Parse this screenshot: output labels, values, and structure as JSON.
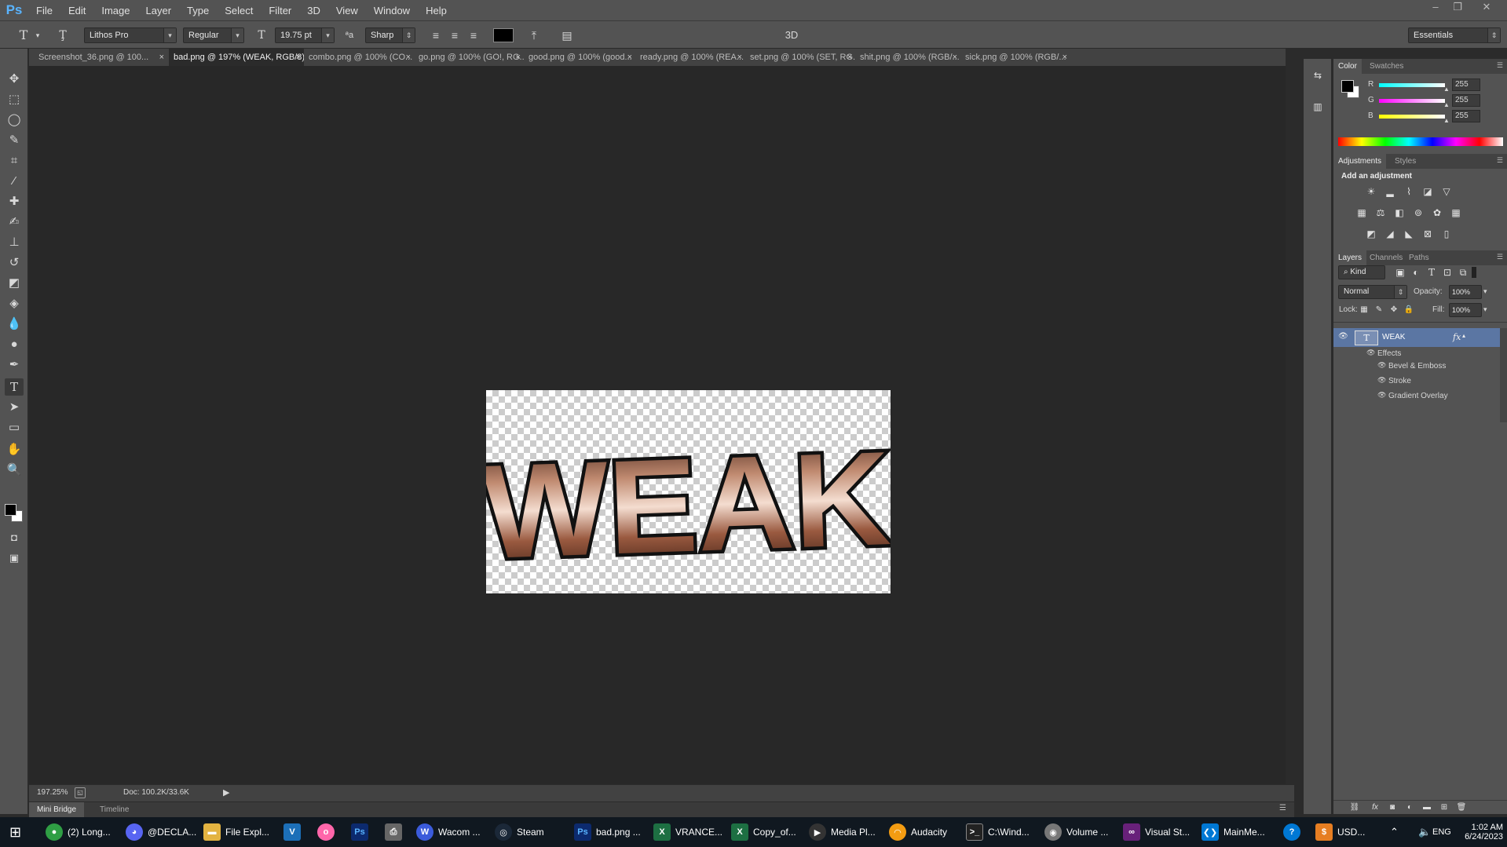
{
  "app": {
    "logo": "Ps"
  },
  "menu": [
    "File",
    "Edit",
    "Image",
    "Layer",
    "Type",
    "Select",
    "Filter",
    "3D",
    "View",
    "Window",
    "Help"
  ],
  "options": {
    "font_family": "Lithos Pro",
    "font_style": "Regular",
    "font_size": "19.75 pt",
    "antialias": "Sharp",
    "label_3d": "3D",
    "workspace": "Essentials",
    "text_color": "#000000"
  },
  "tabs": [
    {
      "label": "Screenshot_36.png @ 100..."
    },
    {
      "label": "bad.png @ 197% (WEAK, RGB/8) *"
    },
    {
      "label": "combo.png @ 100% (CO..."
    },
    {
      "label": "go.png @ 100% (GO!, RG..."
    },
    {
      "label": "good.png @ 100% (good..."
    },
    {
      "label": "ready.png @ 100% (REA..."
    },
    {
      "label": "set.png @ 100% (SET, RG..."
    },
    {
      "label": "shit.png @ 100% (RGB/..."
    },
    {
      "label": "sick.png @ 100% (RGB/..."
    }
  ],
  "canvas": {
    "text": "WEAK"
  },
  "status": {
    "zoom": "197.25%",
    "doc": "Doc: 100.2K/33.6K"
  },
  "bottom_tabs": [
    "Mini Bridge",
    "Timeline"
  ],
  "color_panel": {
    "tabs": [
      "Color",
      "Swatches"
    ],
    "r": "255",
    "g": "255",
    "b": "255",
    "labels": [
      "R",
      "G",
      "B"
    ]
  },
  "adjust_panel": {
    "tabs": [
      "Adjustments",
      "Styles"
    ],
    "heading": "Add an adjustment"
  },
  "layers_panel": {
    "tabs": [
      "Layers",
      "Channels",
      "Paths"
    ],
    "kind": "Kind",
    "blend": "Normal",
    "opacity_label": "Opacity:",
    "opacity": "100%",
    "lock_label": "Lock:",
    "fill_label": "Fill:",
    "fill": "100%",
    "layer_name": "WEAK",
    "effects_label": "Effects",
    "effects": [
      "Bevel & Emboss",
      "Stroke",
      "Gradient Overlay"
    ]
  },
  "taskbar": {
    "items": [
      {
        "label": "(2) Long...",
        "icon": "chrome-icon",
        "color": "#2f9e44"
      },
      {
        "label": "@DECLA...",
        "icon": "discord-icon",
        "color": "#5865f2"
      },
      {
        "label": "File Expl...",
        "icon": "folder-icon",
        "color": "#e3b341"
      },
      {
        "label": "",
        "icon": "vegas-icon",
        "color": "#1c6fb8"
      },
      {
        "label": "",
        "icon": "osu-icon",
        "color": "#ff66aa"
      },
      {
        "label": "",
        "icon": "photoshop-icon",
        "color": "#0c2a6e"
      },
      {
        "label": "",
        "icon": "printer-icon",
        "color": "#666"
      },
      {
        "label": "Wacom ...",
        "icon": "wacom-icon",
        "color": "#3b5bdb"
      },
      {
        "label": "Steam",
        "icon": "steam-icon",
        "color": "#1b2838"
      },
      {
        "label": "bad.png ...",
        "icon": "photoshop-icon",
        "color": "#0c2a6e"
      },
      {
        "label": "VRANCE...",
        "icon": "excel-icon",
        "color": "#1d6f42"
      },
      {
        "label": "Copy_of...",
        "icon": "excel-icon",
        "color": "#1d6f42"
      },
      {
        "label": "Media Pl...",
        "icon": "media-player-icon",
        "color": "#333"
      },
      {
        "label": "Audacity",
        "icon": "audacity-icon",
        "color": "#f39c12"
      },
      {
        "label": "C:\\Wind...",
        "icon": "cmd-icon",
        "color": "#222"
      },
      {
        "label": "Volume ...",
        "icon": "volume-app-icon",
        "color": "#777"
      },
      {
        "label": "Visual St...",
        "icon": "visual-studio-icon",
        "color": "#68217a"
      },
      {
        "label": "MainMe...",
        "icon": "vscode-icon",
        "color": "#0078d4"
      }
    ],
    "tray_text": "USD...",
    "lang": "ENG",
    "time": "1:02 AM",
    "date": "6/24/2023"
  }
}
